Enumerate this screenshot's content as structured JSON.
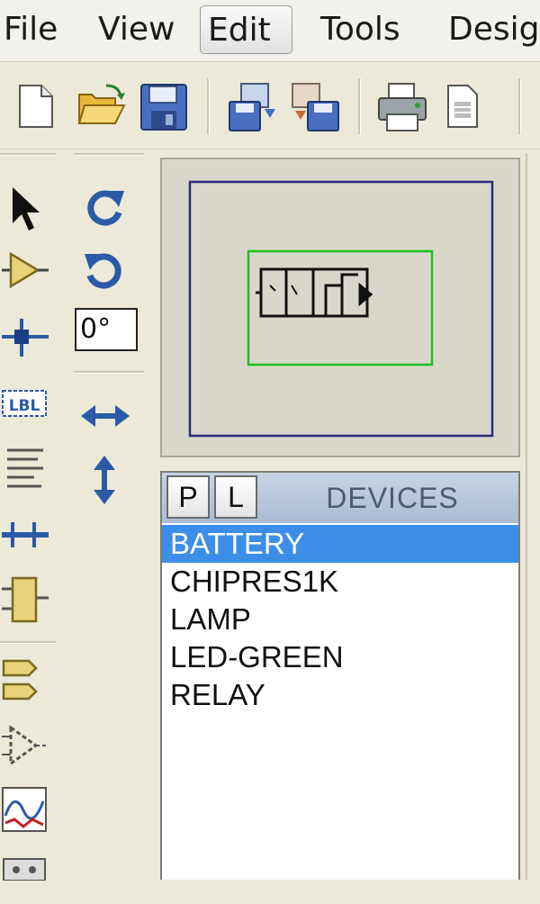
{
  "menubar": {
    "items": [
      {
        "label": "File"
      },
      {
        "label": "View"
      },
      {
        "label": "Edit",
        "active": true
      },
      {
        "label": "Tools"
      },
      {
        "label": "Desig"
      }
    ]
  },
  "toolbar": {
    "buttons": [
      "new-file-icon",
      "open-folder-icon",
      "save-icon",
      "import-icon",
      "export-icon",
      "print-icon",
      "page-setup-icon"
    ]
  },
  "rotate": {
    "angle_value": "0°"
  },
  "devices": {
    "tab_p": "P",
    "tab_l": "L",
    "title": "DEVICES",
    "items": [
      "BATTERY",
      "CHIPRES1K",
      "LAMP",
      "LED-GREEN",
      "RELAY"
    ],
    "selected_index": 0
  },
  "colors": {
    "selection": "#3d8ee8",
    "overview_frame": "#2b2b7a",
    "viewport_frame": "#1fbf1f",
    "icon_blue": "#2a5aa8"
  }
}
